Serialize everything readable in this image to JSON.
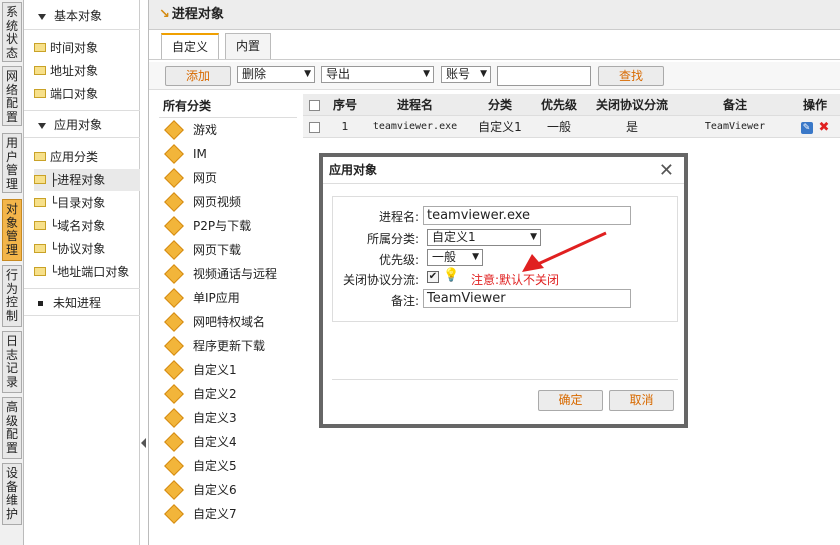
{
  "vtabs": [
    "系统状态",
    "网络配置",
    "用户管理",
    "对象管理",
    "行为控制",
    "日志记录",
    "高级配置",
    "设备维护"
  ],
  "tree": {
    "group1": "基本对象",
    "group1_items": [
      "时间对象",
      "地址对象",
      "端口对象"
    ],
    "group2": "应用对象",
    "group2_items": [
      "应用分类",
      "├进程对象",
      "└目录对象",
      "└域名对象",
      "└协议对象",
      "└地址端口对象"
    ],
    "unknown": "未知进程"
  },
  "page_title": "进程对象",
  "tabs": [
    "自定义",
    "内置"
  ],
  "toolbar": {
    "add": "添加",
    "delete": "删除",
    "export": "导出",
    "account": "账号",
    "search": "查找"
  },
  "categories": {
    "header": "所有分类",
    "items": [
      "游戏",
      "IM",
      "网页",
      "网页视频",
      "P2P与下载",
      "网页下载",
      "视频通话与远程",
      "单IP应用",
      "网吧特权域名",
      "程序更新下载",
      "自定义1",
      "自定义2",
      "自定义3",
      "自定义4",
      "自定义5",
      "自定义6",
      "自定义7"
    ]
  },
  "table": {
    "headers": [
      "序号",
      "进程名",
      "分类",
      "优先级",
      "关闭协议分流",
      "备注",
      "操作"
    ],
    "rows": [
      {
        "no": "1",
        "name": "teamviewer.exe",
        "category": "自定义1",
        "priority": "一般",
        "close_flow": "是",
        "note": "TeamViewer"
      }
    ]
  },
  "dialog": {
    "title": "应用对象",
    "labels": {
      "name": "进程名:",
      "category": "所属分类:",
      "priority": "优先级:",
      "close_flow": "关闭协议分流:",
      "note": "备注:"
    },
    "values": {
      "name": "teamviewer.exe",
      "category": "自定义1",
      "priority": "一般",
      "note": "TeamViewer"
    },
    "hint": "注意:默认不关闭",
    "ok": "确定",
    "cancel": "取消"
  },
  "colors": {
    "accent": "#f0a000",
    "hint": "#e02020",
    "active_tab": "#f3b54a"
  }
}
